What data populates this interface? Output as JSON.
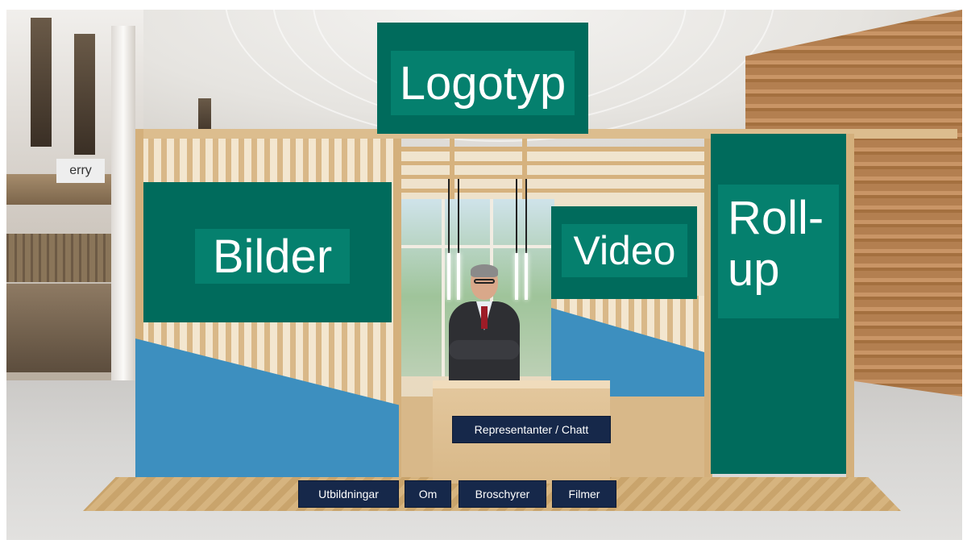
{
  "booth": {
    "logo_label": "Logotyp",
    "images_label": "Bilder",
    "video_label": "Video",
    "rollup_label": "Roll-\nup",
    "mall_sign_text": "erry"
  },
  "nav": {
    "representatives_chat": "Representanter / Chatt",
    "education": "Utbildningar",
    "about": "Om",
    "brochures": "Broschyrer",
    "films": "Filmer"
  },
  "colors": {
    "sign_dark": "#006b5c",
    "sign_light": "#05806e",
    "button_bg": "#16284a",
    "blue_panel": "#3d8fbf"
  }
}
